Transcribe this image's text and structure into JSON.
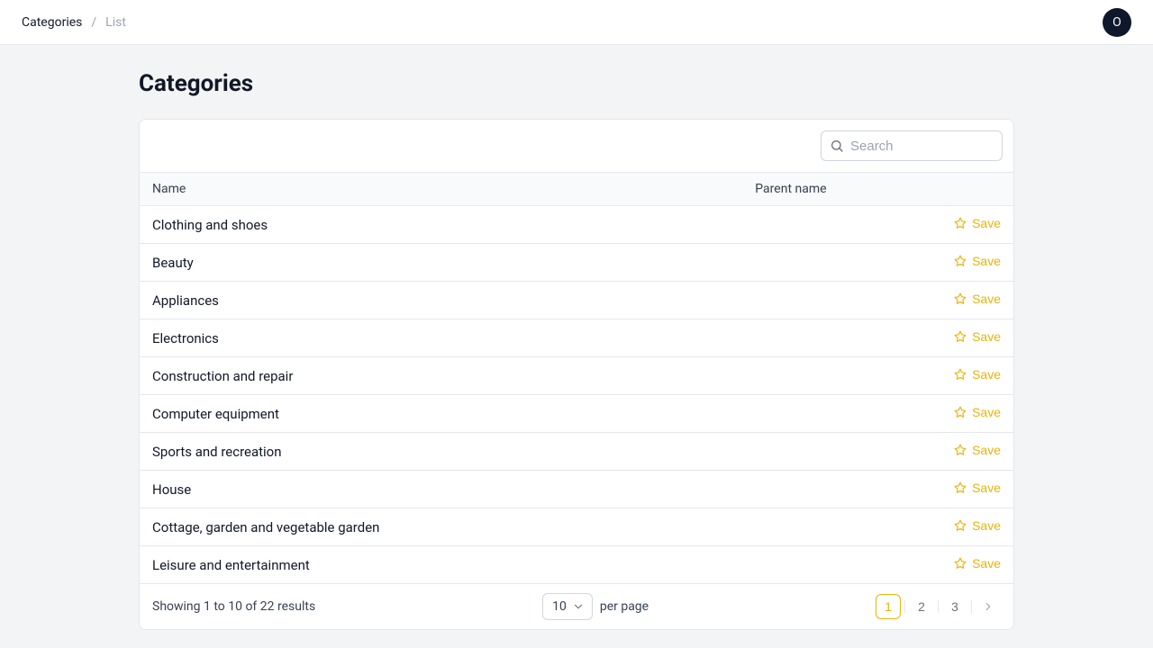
{
  "breadcrumb": {
    "root": "Categories",
    "current": "List"
  },
  "avatar_initial": "O",
  "page_title": "Categories",
  "search": {
    "placeholder": "Search",
    "value": ""
  },
  "table": {
    "columns": {
      "name": "Name",
      "parent": "Parent name"
    },
    "action_label": "Save",
    "rows": [
      {
        "name": "Clothing and shoes",
        "parent": ""
      },
      {
        "name": "Beauty",
        "parent": ""
      },
      {
        "name": "Appliances",
        "parent": ""
      },
      {
        "name": "Electronics",
        "parent": ""
      },
      {
        "name": "Construction and repair",
        "parent": ""
      },
      {
        "name": "Computer equipment",
        "parent": ""
      },
      {
        "name": "Sports and recreation",
        "parent": ""
      },
      {
        "name": "House",
        "parent": ""
      },
      {
        "name": "Cottage, garden and vegetable garden",
        "parent": ""
      },
      {
        "name": "Leisure and entertainment",
        "parent": ""
      }
    ]
  },
  "pagination": {
    "summary": "Showing 1 to 10 of 22 results",
    "per_page_value": "10",
    "per_page_suffix": "per page",
    "pages": [
      "1",
      "2",
      "3"
    ],
    "active_page": "1"
  }
}
